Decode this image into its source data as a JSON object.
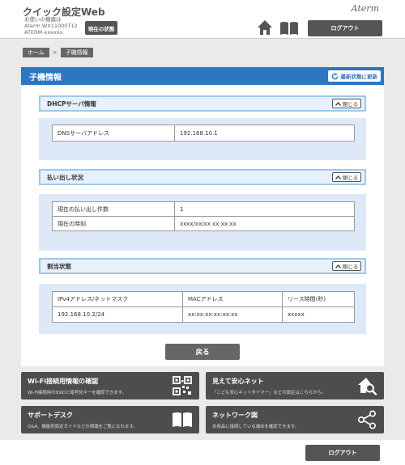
{
  "header": {
    "app_title": "クイック設定Web",
    "device_label": "お使いの機器は",
    "device_model": "Aterm WX11000T12",
    "device_ssid": "ATERM-xxxxxx",
    "status_button": "現在の状態",
    "logo": "Aterm",
    "logout_button": "ログアウト"
  },
  "breadcrumb": {
    "home": "ホーム",
    "separator": ">",
    "current": "子機情報"
  },
  "page": {
    "title": "子機情報",
    "refresh_button": "最新状態に更新",
    "collapse_label": "閉じる"
  },
  "sections": {
    "dhcp": {
      "title": "DHCPサーバ情報",
      "rows": [
        {
          "label": "DNSサーバアドレス",
          "value": "192.168.10.1"
        }
      ]
    },
    "lease": {
      "title": "払い出し状況",
      "rows": [
        {
          "label": "現在の払い出し件数",
          "value": "1"
        },
        {
          "label": "現在の時刻",
          "value": "xxxx/xx/xx xx:xx:xx"
        }
      ]
    },
    "assign": {
      "title": "割当状態",
      "headers": [
        "IPv4アドレス/ネットマスク",
        "MACアドレス",
        "リース時間(秒)"
      ],
      "rows": [
        [
          "192.168.10.2/24",
          "xx:xx:xx:xx:xx:xx",
          "xxxxx"
        ]
      ]
    }
  },
  "back_button": "戻る",
  "tiles": [
    {
      "title": "Wi-Fi接続用情報の確認",
      "desc": "Wi-Fi接続用のSSIDと暗号化キーを確認できます。",
      "icon": "qr-code-icon"
    },
    {
      "title": "見えて安心ネット",
      "desc": "「こども安心ネットタイマー」などの設定はこちらから。",
      "icon": "house-search-icon"
    },
    {
      "title": "サポートデスク",
      "desc": "Q&A、機能別設定ガイドなどの情報をご覧になれます。",
      "icon": "open-book-icon"
    },
    {
      "title": "ネットワーク図",
      "desc": "本商品に接続している端末を確認できます。",
      "icon": "share-network-icon"
    }
  ],
  "footer": {
    "logout_button": "ログアウト"
  },
  "colors": {
    "accent": "#2d76c2",
    "section_border": "#9cc8ee",
    "section_bg": "#dde9f7",
    "tile_bg": "#4d4d4d"
  }
}
